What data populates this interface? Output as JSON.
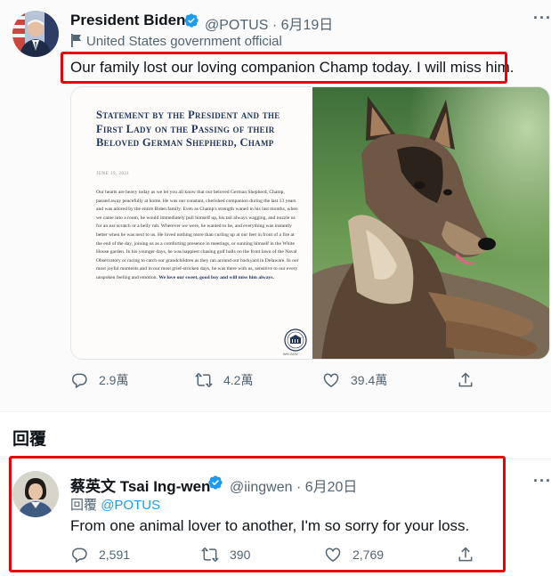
{
  "tweet1": {
    "author_name": "President Biden",
    "handle": "@POTUS",
    "separator": "·",
    "date": "6月19日",
    "gov_label": "United States government official",
    "text": "Our family lost our loving companion Champ today. I will miss him.",
    "statement": {
      "title": "Statement by the President and the First Lady on the Passing of their Beloved German Shepherd, Champ",
      "date": "JUNE 19, 2021",
      "body": "Our hearts are heavy today as we let you all know that our beloved German Shepherd, Champ, passed away peacefully at home. He was our constant, cherished companion during the last 13 years and was adored by the entire Biden family. Even as Champ's strength waned in his last months, when we came into a room, he would immediately pull himself up, his tail always wagging, and nuzzle us for an ear scratch or a belly rub. Wherever we were, he wanted to be, and everything was instantly better when he was next to us. He loved nothing more than curling up at our feet in front of a fire at the end of the day, joining us as a comforting presence in meetings, or sunning himself in the White House garden. In his younger days, he was happiest chasing golf balls on the front lawn of the Naval Observatory or racing to catch our grandchildren as they ran around our backyard in Delaware. In our most joyful moments and in our most grief-stricken days, he was there with us, sensitive to our every unspoken feeling and emotion.",
      "closing": "We love our sweet, good boy and will miss him always.",
      "seal_text": "WH.GOV"
    },
    "stats": {
      "replies": "2.9萬",
      "retweets": "4.2萬",
      "likes": "39.4萬"
    }
  },
  "section_label": "回覆",
  "tweet2": {
    "author_name": "蔡英文 Tsai Ing-wen",
    "handle": "@iingwen",
    "separator": "·",
    "date": "6月20日",
    "reply_prefix": "回覆",
    "reply_to": "@POTUS",
    "text": "From one animal lover to another, I'm so sorry for your loss.",
    "stats": {
      "replies": "2,591",
      "retweets": "390",
      "likes": "2,769"
    }
  },
  "icons": [
    "verified-badge-icon",
    "government-flag-icon",
    "reply-icon",
    "retweet-icon",
    "like-icon",
    "share-icon",
    "more-icon"
  ],
  "colors": {
    "highlight_box": "#e8000b",
    "verified": "#1d9bf0",
    "link": "#1d9bf0",
    "secondary_text": "#536471",
    "statement_title": "#22355e"
  }
}
